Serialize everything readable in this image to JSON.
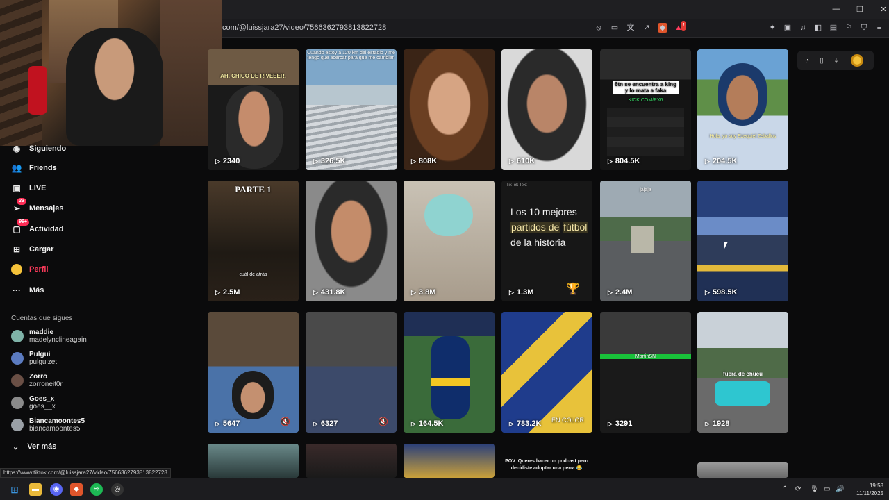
{
  "browser": {
    "url": "com/@luissjara27/video/7566362793813822728",
    "hover_url": "https://www.tiktok.com/@luissjara27/video/7566362793813822728"
  },
  "sidebar": {
    "items": [
      {
        "label": "Siguiendo",
        "icon": "following-icon"
      },
      {
        "label": "Friends",
        "icon": "friends-icon"
      },
      {
        "label": "LIVE",
        "icon": "live-icon"
      },
      {
        "label": "Mensajes",
        "icon": "messages-icon",
        "badge": "23"
      },
      {
        "label": "Actividad",
        "icon": "activity-icon",
        "badge": "99+"
      },
      {
        "label": "Cargar",
        "icon": "upload-icon"
      },
      {
        "label": "Perfil",
        "icon": "profile-icon"
      },
      {
        "label": "Más",
        "icon": "more-icon"
      }
    ],
    "following_heading": "Cuentas que sigues",
    "accounts": [
      {
        "name": "maddie",
        "handle": "madelynclineagain"
      },
      {
        "name": "Pulgui",
        "handle": "pulguizet"
      },
      {
        "name": "Zorro",
        "handle": "zorroneit0r"
      },
      {
        "name": "Goes_x",
        "handle": "goes__x"
      },
      {
        "name": "Biancamoontes5",
        "handle": "biancamoontes5"
      }
    ],
    "see_more": "Ver más"
  },
  "videos": [
    {
      "views": "2340",
      "caption": "AH, CHICO DE RIVEEER."
    },
    {
      "views": "326.5K",
      "caption": "Cuando estoy a 120 km del estadio y me tengo que acercar para que me cambien"
    },
    {
      "views": "808K",
      "caption": ""
    },
    {
      "views": "610K",
      "caption": ""
    },
    {
      "views": "804.5K",
      "caption": "6tn se encuentra a king y lo mata a faka",
      "caption2": "KICK.COM/PX6"
    },
    {
      "views": "204.5K",
      "caption": "Hola, yo soy Exequiel Zeballos"
    },
    {
      "views": "2.5M",
      "caption": "PARTE 1",
      "caption2": "cuál de atrás"
    },
    {
      "views": "431.8K",
      "caption": ""
    },
    {
      "views": "3.8M",
      "caption": ""
    },
    {
      "views": "1.3M",
      "caption": "TikTok Text",
      "text_parts": [
        "Los 10 mejores ",
        "partidos de",
        " ",
        "fútbol",
        " de la historia"
      ]
    },
    {
      "views": "2.4M",
      "caption": "jajaja"
    },
    {
      "views": "598.5K",
      "caption": ""
    },
    {
      "views": "5647",
      "caption": ""
    },
    {
      "views": "6327",
      "caption": ""
    },
    {
      "views": "164.5K",
      "caption": ""
    },
    {
      "views": "783.2K",
      "caption": "EN COLOR"
    },
    {
      "views": "3291",
      "caption": "MartinSN"
    },
    {
      "views": "1928",
      "caption": "fuera de chucu"
    }
  ],
  "partial_row": {
    "pov_text": "POV: Queres hacer un podcast pero decidiste adoptar una perra 😂"
  },
  "taskbar": {
    "time": "19:58",
    "date": "11/11/2025"
  }
}
